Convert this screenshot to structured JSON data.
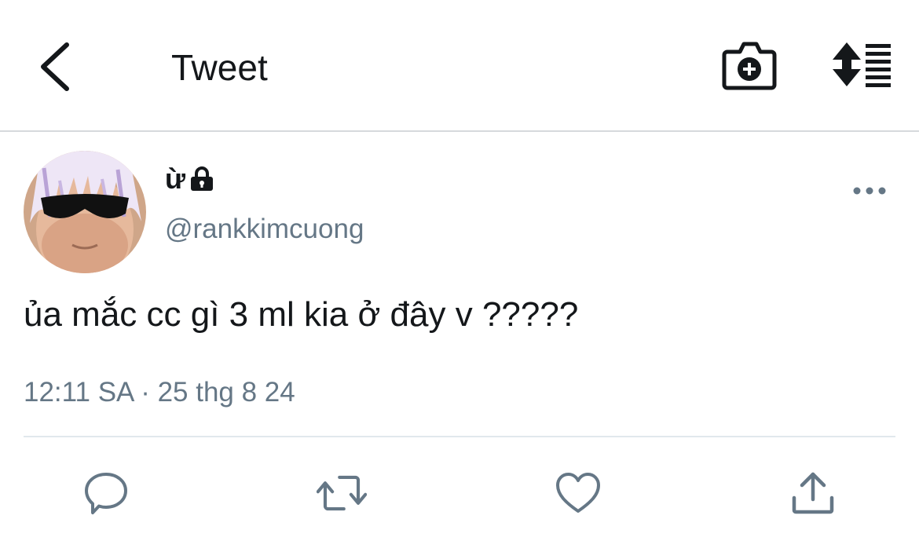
{
  "header": {
    "title": "Tweet",
    "icons": {
      "back": "chevron-left-icon",
      "camera": "camera-plus-icon",
      "sort": "sort-list-icon"
    }
  },
  "tweet": {
    "author": {
      "display_name": "ừ",
      "handle": "@rankkimcuong",
      "protected": true
    },
    "text": "ủa mắc cc gì 3 ml kia ở đây v ?????",
    "timestamp": "12:11 SA · 25 thg 8 24",
    "actions": [
      "reply",
      "retweet",
      "like",
      "share"
    ]
  },
  "colors": {
    "text": "#14171a",
    "secondary": "#657786",
    "divider": "#e1e8ed",
    "icon": "#657786"
  }
}
